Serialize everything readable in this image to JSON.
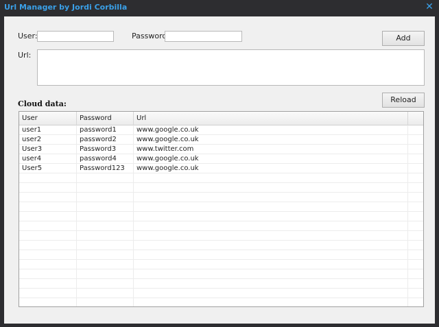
{
  "window": {
    "title": "Url Manager by Jordi Corbilla",
    "close_glyph": "✕"
  },
  "form": {
    "user_label": "User:",
    "user_value": "",
    "password_label": "Password:",
    "password_value": "",
    "url_label": "Url:",
    "url_value": "",
    "add_label": "Add"
  },
  "cloud": {
    "section_label": "Cloud data:",
    "reload_label": "Reload",
    "columns": [
      "User",
      "Password",
      "Url"
    ],
    "rows": [
      [
        "user1",
        "password1",
        "www.google.co.uk"
      ],
      [
        "user2",
        "password2",
        "www.google.co.uk"
      ],
      [
        "User3",
        "Password3",
        "www.twitter.com"
      ],
      [
        "user4",
        "password4",
        "www.google.co.uk"
      ],
      [
        "User5",
        "Password123",
        "www.google.co.uk"
      ]
    ]
  },
  "colors": {
    "title_accent": "#3aa0e8",
    "chrome": "#2d2d30",
    "client": "#f0f0f0"
  }
}
